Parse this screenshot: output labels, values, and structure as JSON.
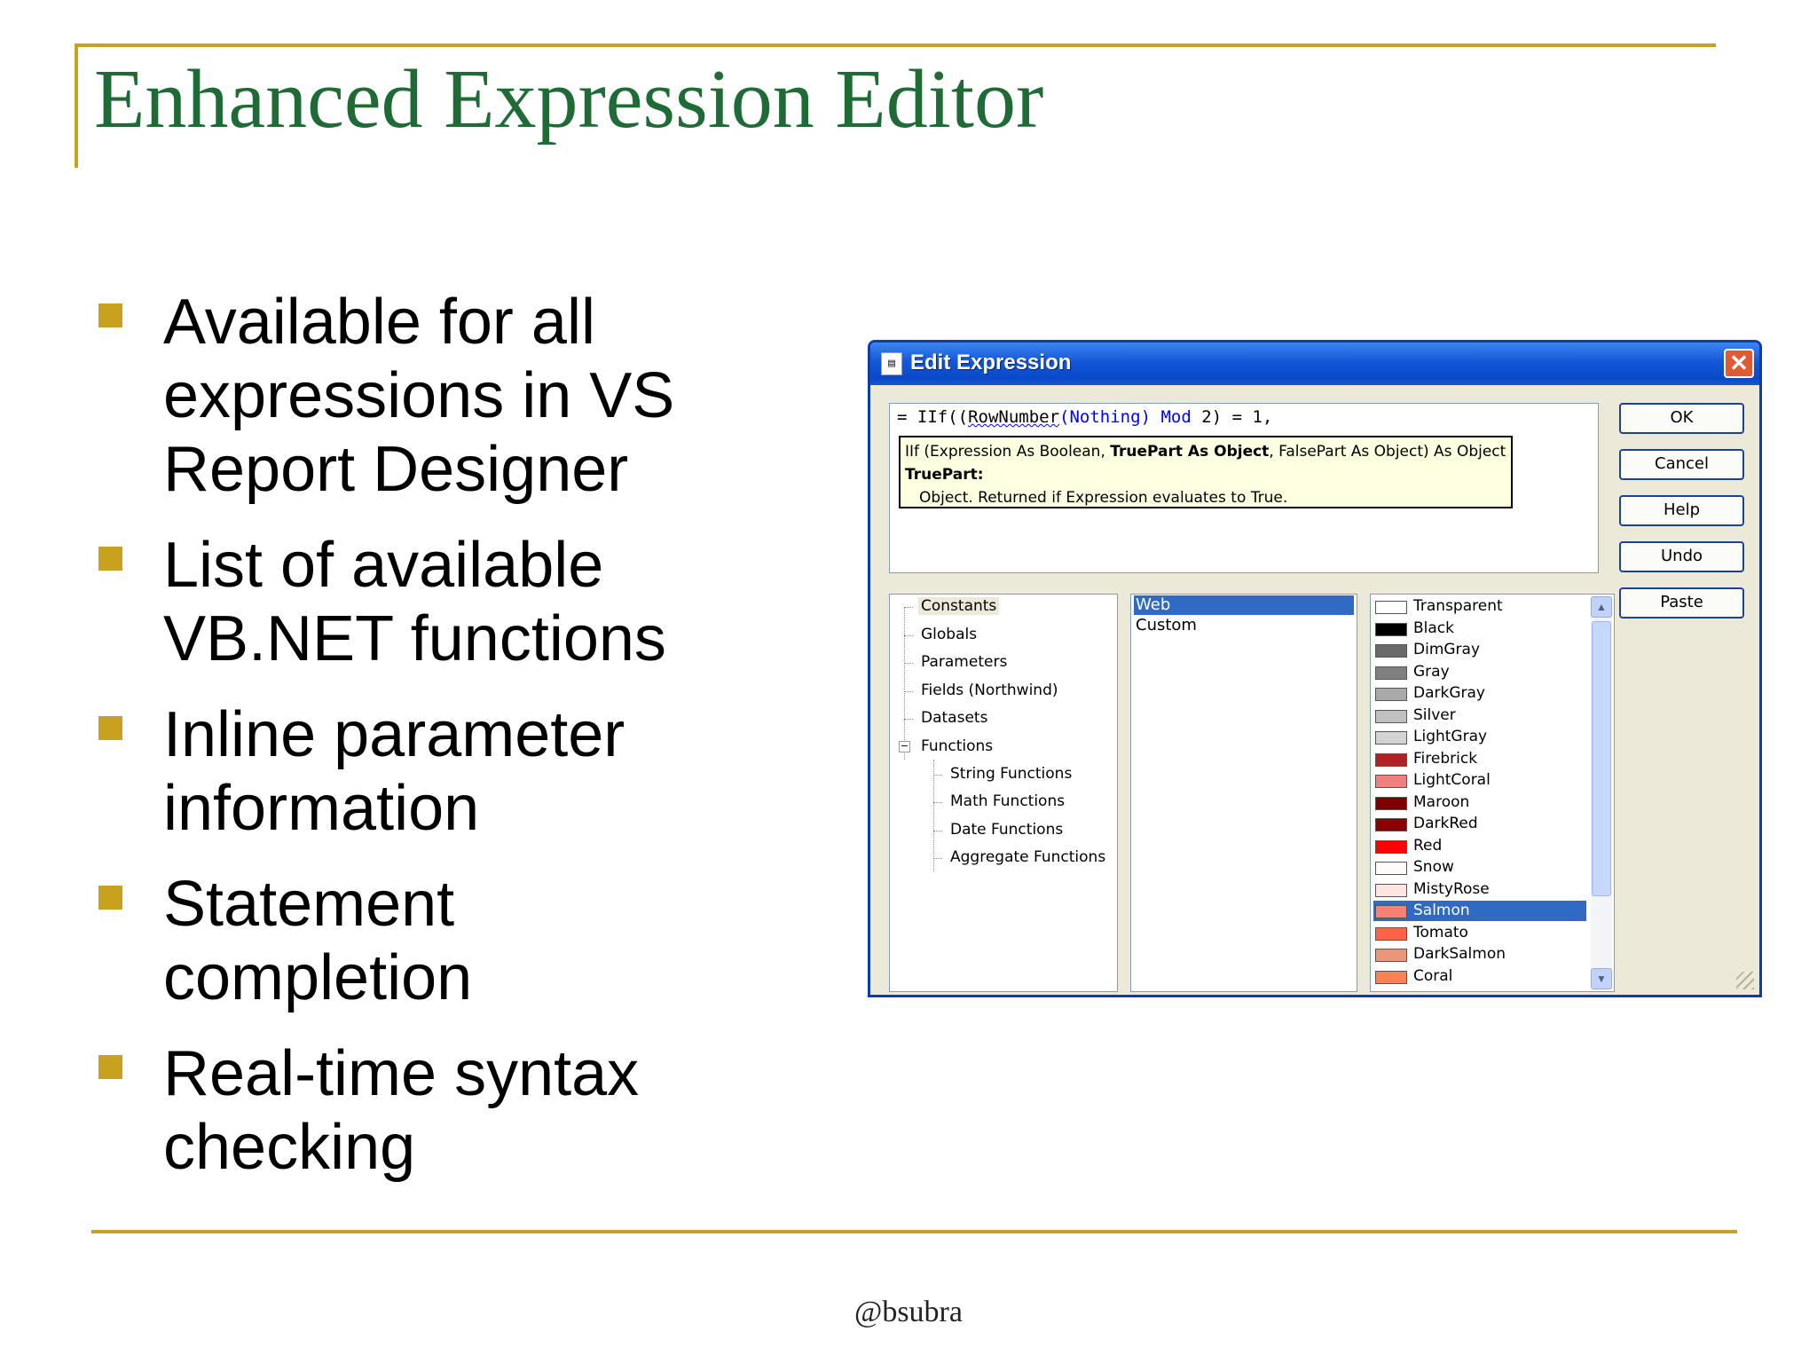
{
  "slide": {
    "title": "Enhanced Expression Editor",
    "footer": "@bsubra",
    "bullets": [
      "Available for all expressions in VS Report Designer",
      "List of available VB.NET functions",
      "Inline parameter information",
      "Statement completion",
      "Real-time syntax checking"
    ],
    "accent_color": "#c8a21e",
    "title_color": "#1e6b36"
  },
  "dialog": {
    "title": "Edit Expression",
    "close_icon": "close-icon",
    "expression": {
      "prefix": "= IIf((",
      "func": "RowNumber",
      "open": "(",
      "arg": "Nothing",
      "close": ")",
      "mod": "Mod",
      "rest": "2) = 1,"
    },
    "tooltip": {
      "sig_start": "IIf (Expression As Boolean, ",
      "sig_bold": "TruePart As Object",
      "sig_end": ", FalsePart As Object) As Object",
      "param_name": "TruePart:",
      "param_desc": "Object. Returned if Expression evaluates to True."
    },
    "buttons": {
      "ok": "OK",
      "cancel": "Cancel",
      "help": "Help",
      "undo": "Undo",
      "paste": "Paste"
    },
    "tree": {
      "items": [
        "Constants",
        "Globals",
        "Parameters",
        "Fields (Northwind)",
        "Datasets",
        "Functions"
      ],
      "functions": [
        "String Functions",
        "Math Functions",
        "Date Functions",
        "Aggregate Functions"
      ],
      "expander": "−"
    },
    "categories": [
      "Web",
      "Custom"
    ],
    "colors": [
      {
        "name": "Transparent",
        "hex": "#ffffff"
      },
      {
        "name": "Black",
        "hex": "#000000"
      },
      {
        "name": "DimGray",
        "hex": "#696969"
      },
      {
        "name": "Gray",
        "hex": "#808080"
      },
      {
        "name": "DarkGray",
        "hex": "#a9a9a9"
      },
      {
        "name": "Silver",
        "hex": "#c0c0c0"
      },
      {
        "name": "LightGray",
        "hex": "#d3d3d3"
      },
      {
        "name": "Firebrick",
        "hex": "#b22222"
      },
      {
        "name": "LightCoral",
        "hex": "#f08080"
      },
      {
        "name": "Maroon",
        "hex": "#800000"
      },
      {
        "name": "DarkRed",
        "hex": "#8b0000"
      },
      {
        "name": "Red",
        "hex": "#ff0000"
      },
      {
        "name": "Snow",
        "hex": "#fffafa"
      },
      {
        "name": "MistyRose",
        "hex": "#ffe4e1"
      },
      {
        "name": "Salmon",
        "hex": "#fa8072"
      },
      {
        "name": "Tomato",
        "hex": "#ff6347"
      },
      {
        "name": "DarkSalmon",
        "hex": "#e9967a"
      },
      {
        "name": "Coral",
        "hex": "#ff7f50"
      }
    ],
    "selected_color": "Salmon"
  }
}
